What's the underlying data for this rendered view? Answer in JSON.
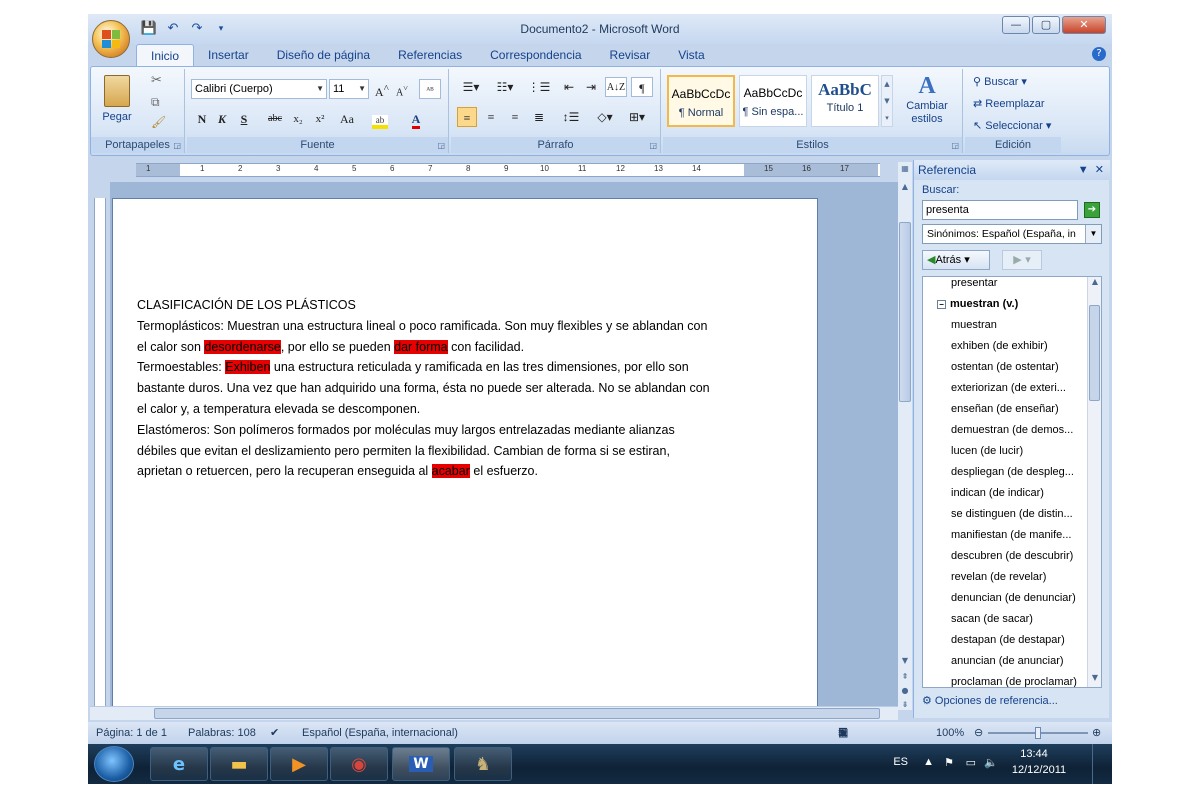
{
  "window": {
    "title": "Documento2 - Microsoft Word",
    "close": "✕",
    "minimize": "—",
    "maximize": "▢"
  },
  "ribbon": {
    "tabs": [
      "Inicio",
      "Insertar",
      "Diseño de página",
      "Referencias",
      "Correspondencia",
      "Revisar",
      "Vista"
    ],
    "groups": {
      "clipboard": "Portapapeles",
      "font": "Fuente",
      "paragraph": "Párrafo",
      "styles": "Estilos",
      "editing": "Edición"
    },
    "paste_label": "Pegar",
    "font_name": "Calibri (Cuerpo)",
    "font_size": "11",
    "bold": "N",
    "italic": "K",
    "underline": "S",
    "strike": "abc",
    "subscript": "x₂",
    "superscript": "x²",
    "case": "Aa",
    "styles": [
      {
        "preview": "AaBbCcDc",
        "name": "¶ Normal"
      },
      {
        "preview": "AaBbCcDc",
        "name": "¶ Sin espa..."
      },
      {
        "preview": "AaBbC",
        "name": "Título 1"
      }
    ],
    "change_styles": "Cambiar estilos",
    "find": "Buscar",
    "replace": "Reemplazar",
    "select": "Seleccionar"
  },
  "ruler": {
    "numbers": [
      "1",
      "2",
      "1",
      "2",
      "3",
      "4",
      "5",
      "6",
      "7",
      "8",
      "9",
      "10",
      "11",
      "12",
      "13",
      "14",
      "15",
      "16",
      "17"
    ]
  },
  "document": {
    "heading": "CLASIFICACIÓN DE LOS PLÁSTICOS",
    "p1a": "Termoplásticos: Muestran una estructura  lineal  o poco ramificada. Son muy flexibles y se ablandan  con el calor son ",
    "p1_hl1": "desordenarse",
    "p1b": ", por ello se pueden ",
    "p1_hl2": "dar forma",
    "p1c": "  con facilidad.",
    "p2a": "Termoestables: ",
    "p2_hl": "Exhiben",
    "p2b": " una estructura reticulada y ramificada en las tres dimensiones, por ello son bastante duros. Una vez que han adquirido una forma, ésta no puede ser alterada. No se ablandan con el calor y, a temperatura elevada se descomponen.",
    "p3a": "Elastómeros: Son polímeros formados por moléculas muy largos entrelazadas mediante alianzas débiles que evitan el deslizamiento pero permiten la flexibilidad. Cambian de forma si se estiran, aprietan o retuercen, pero la recuperan enseguida al ",
    "p3_hl": "acabar",
    "p3b": " el esfuerzo."
  },
  "pane": {
    "title": "Referencia",
    "search_label": "Buscar:",
    "search_value": "presenta",
    "source": "Sinónimos: Español (España, in",
    "back": "Atrás",
    "results": [
      {
        "text": "presentar",
        "header": false
      },
      {
        "text": "muestran (v.)",
        "header": true
      },
      {
        "text": "muestran",
        "header": false
      },
      {
        "text": "exhiben (de exhibir)",
        "header": false
      },
      {
        "text": "ostentan (de ostentar)",
        "header": false
      },
      {
        "text": "exteriorizan (de exteri...",
        "header": false
      },
      {
        "text": "enseñan (de enseñar)",
        "header": false
      },
      {
        "text": "demuestran (de demos...",
        "header": false
      },
      {
        "text": "lucen (de lucir)",
        "header": false
      },
      {
        "text": "despliegan (de despleg...",
        "header": false
      },
      {
        "text": "indican (de indicar)",
        "header": false
      },
      {
        "text": "se distinguen (de distin...",
        "header": false
      },
      {
        "text": "manifiestan (de manife...",
        "header": false
      },
      {
        "text": "descubren (de descubrir)",
        "header": false
      },
      {
        "text": "revelan (de revelar)",
        "header": false
      },
      {
        "text": "denuncian (de denunciar)",
        "header": false
      },
      {
        "text": "sacan (de sacar)",
        "header": false
      },
      {
        "text": "destapan (de destapar)",
        "header": false
      },
      {
        "text": "anuncian (de anunciar)",
        "header": false
      },
      {
        "text": "proclaman (de proclamar)",
        "header": false
      }
    ],
    "options": "Opciones de referencia..."
  },
  "status": {
    "page": "Página: 1 de 1",
    "words": "Palabras: 108",
    "language": "Español (España, internacional)",
    "zoom": "100%",
    "zoom_level": 0.5
  },
  "taskbar": {
    "lang": "ES",
    "time": "13:44",
    "date": "12/12/2011"
  },
  "colors": {
    "highlight": "#e60000",
    "accent": "#15428b"
  }
}
